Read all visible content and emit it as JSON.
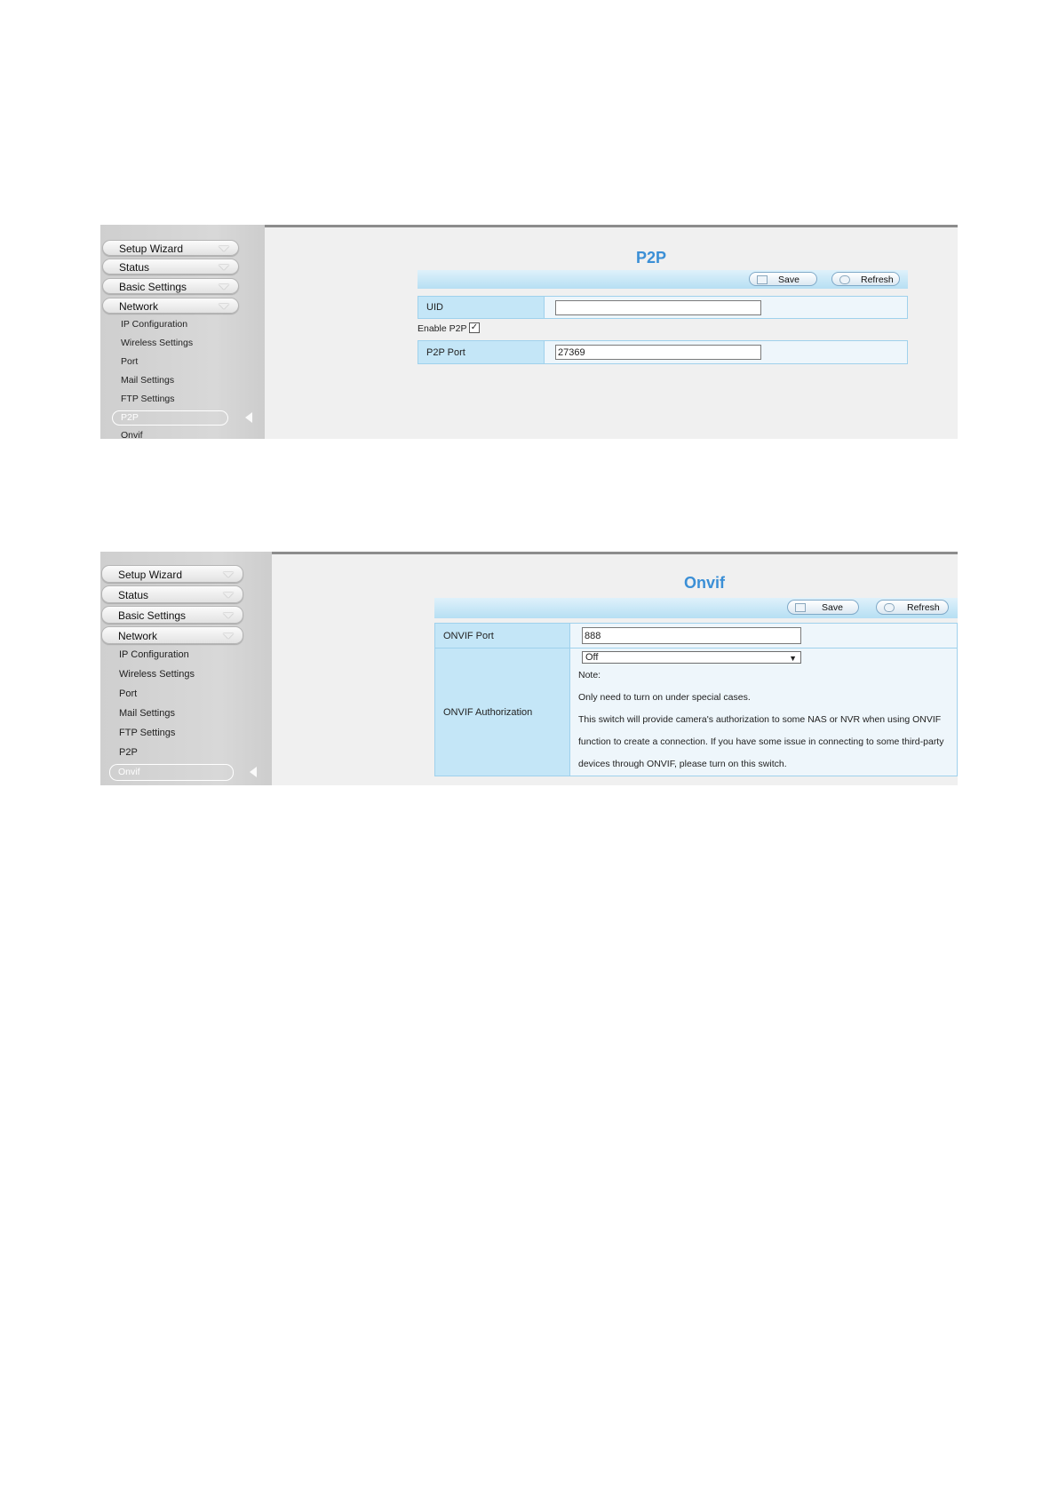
{
  "shots": [
    {
      "title": "P2P",
      "sidebar": {
        "main_items": [
          "Setup Wizard",
          "Status",
          "Basic Settings",
          "Network"
        ],
        "sub_items": [
          "IP Configuration",
          "Wireless Settings",
          "Port",
          "Mail Settings",
          "FTP Settings"
        ],
        "active_item": "P2P",
        "trailing_item": "Onvif"
      },
      "toolbar": {
        "save_label": "Save",
        "refresh_label": "Refresh"
      },
      "fields": {
        "uid_label": "UID",
        "uid_value": "",
        "enable_label": "Enable P2P",
        "enable_checked": true,
        "port_label": "P2P Port",
        "port_value": "27369"
      }
    },
    {
      "title": "Onvif",
      "sidebar": {
        "main_items": [
          "Setup Wizard",
          "Status",
          "Basic Settings",
          "Network"
        ],
        "sub_items": [
          "IP Configuration",
          "Wireless Settings",
          "Port",
          "Mail Settings",
          "FTP Settings",
          "P2P"
        ],
        "active_item": "Onvif"
      },
      "toolbar": {
        "save_label": "Save",
        "refresh_label": "Refresh"
      },
      "fields": {
        "port_label": "ONVIF Port",
        "port_value": "888",
        "auth_label": "ONVIF Authorization",
        "auth_value": "Off",
        "note_label": "Note:",
        "note_lines": [
          "Only need to turn on under special cases.",
          "This switch will provide camera's authorization to some NAS or NVR when using ONVIF",
          "function to create a connection. If you have some issue in connecting to some third-party",
          "devices through ONVIF, please turn on this switch."
        ]
      }
    }
  ],
  "colors": {
    "title_blue": "#3b8fd6",
    "label_blue": "#c4e6f7",
    "toolbar_blue": "#b6dff3"
  },
  "icons": {
    "save": "save-icon",
    "refresh": "refresh-icon",
    "menu_arrow": "chevron-down-icon",
    "selection": "selection-arrow-icon"
  }
}
